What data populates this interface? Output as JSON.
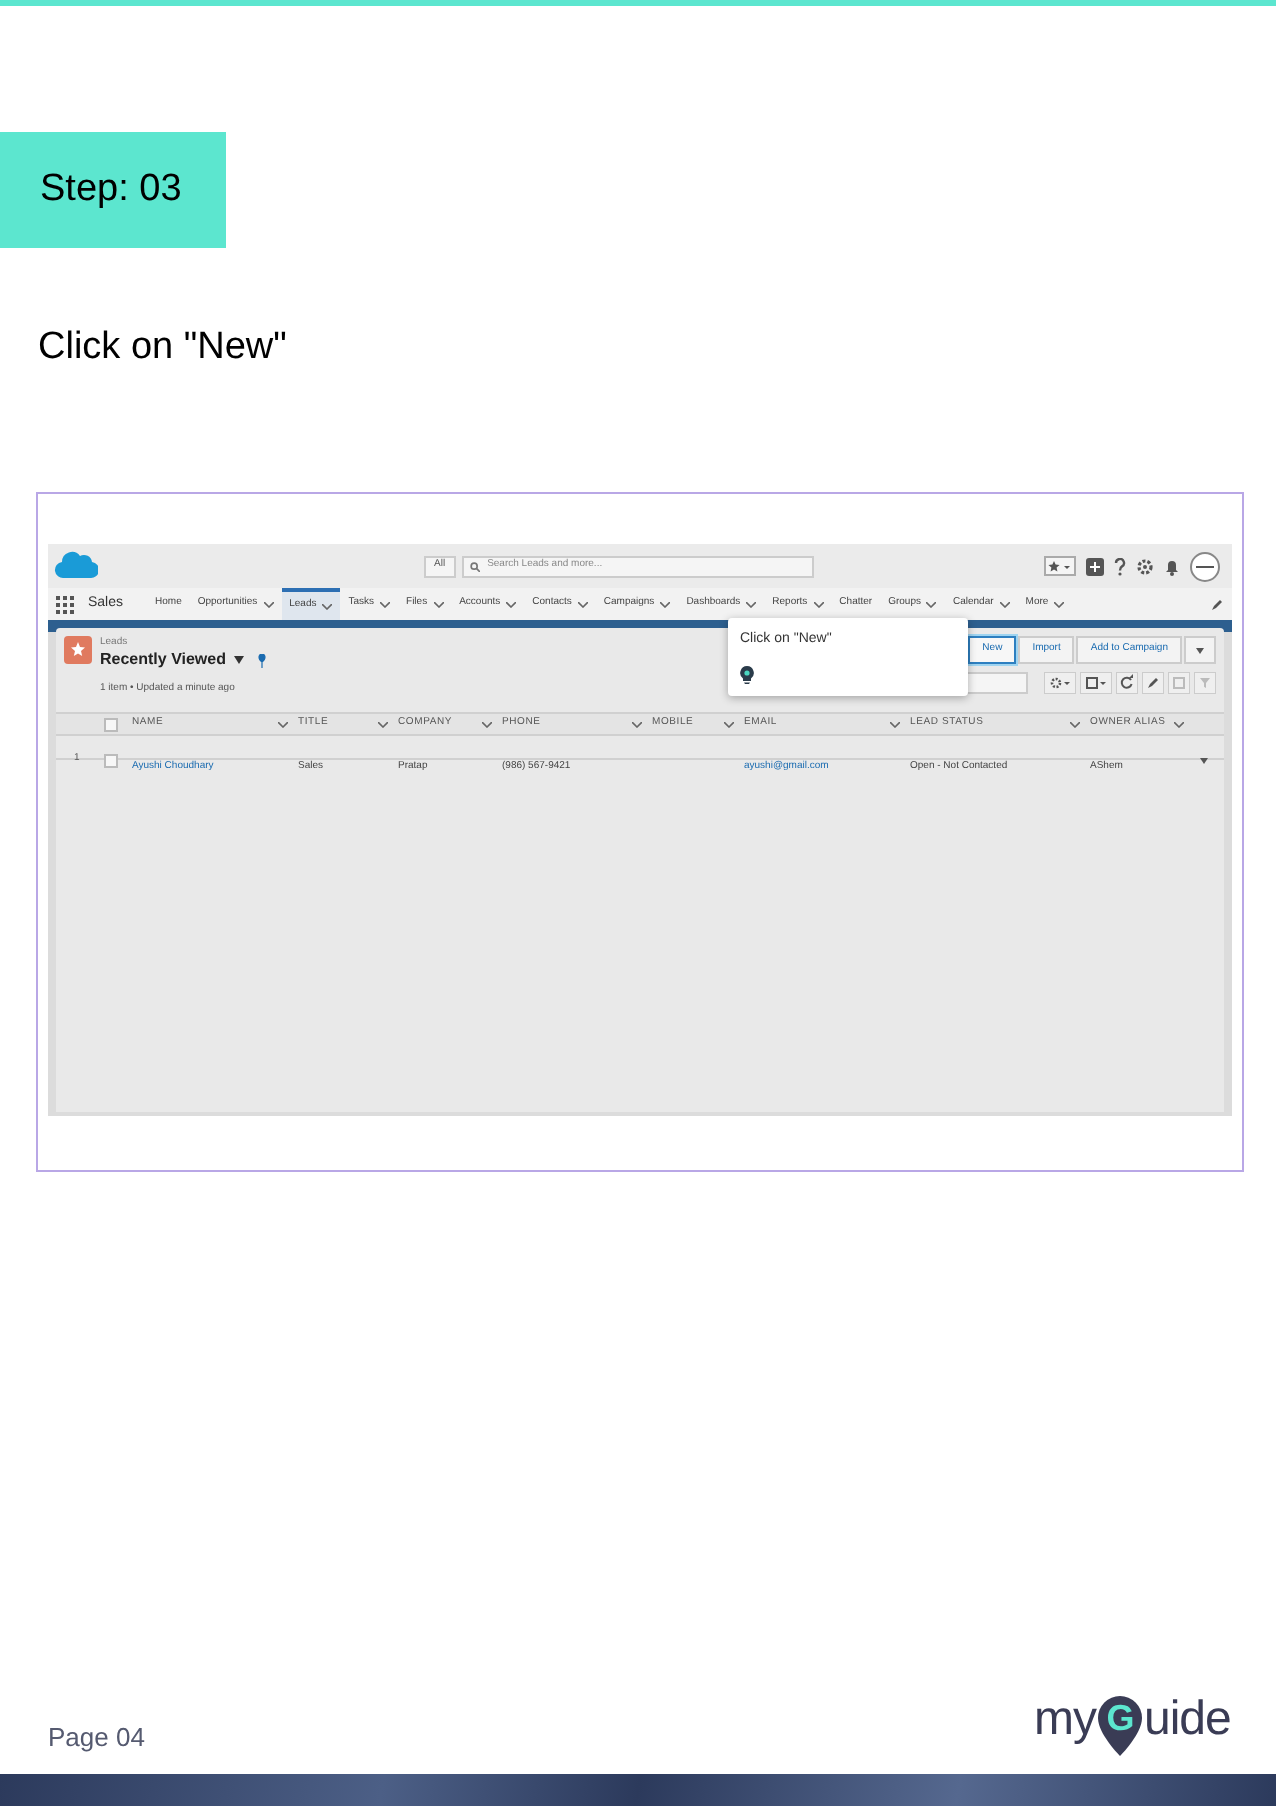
{
  "step": "Step: 03",
  "instruction": "Click on \"New\"",
  "app": {
    "search_scope": "All",
    "search_placeholder": "Search Leads and more...",
    "app_name": "Sales",
    "nav": [
      {
        "label": "Home",
        "selected": false,
        "dropdown": false
      },
      {
        "label": "Opportunities",
        "selected": false,
        "dropdown": true
      },
      {
        "label": "Leads",
        "selected": true,
        "dropdown": true
      },
      {
        "label": "Tasks",
        "selected": false,
        "dropdown": true
      },
      {
        "label": "Files",
        "selected": false,
        "dropdown": true
      },
      {
        "label": "Accounts",
        "selected": false,
        "dropdown": true
      },
      {
        "label": "Contacts",
        "selected": false,
        "dropdown": true
      },
      {
        "label": "Campaigns",
        "selected": false,
        "dropdown": true
      },
      {
        "label": "Dashboards",
        "selected": false,
        "dropdown": true
      },
      {
        "label": "Reports",
        "selected": false,
        "dropdown": true
      },
      {
        "label": "Chatter",
        "selected": false,
        "dropdown": false
      },
      {
        "label": "Groups",
        "selected": false,
        "dropdown": true
      },
      {
        "label": "Calendar",
        "selected": false,
        "dropdown": true
      },
      {
        "label": "More",
        "selected": false,
        "dropdown": true
      }
    ],
    "object_label": "Leads",
    "list_view": "Recently Viewed",
    "meta": "1 item • Updated a minute ago",
    "buttons": [
      {
        "label": "New",
        "highlighted": true
      },
      {
        "label": "Import",
        "highlighted": false
      },
      {
        "label": "Add to Campaign",
        "highlighted": false
      }
    ],
    "select_all_checked": false,
    "columns": [
      "NAME",
      "TITLE",
      "COMPANY",
      "PHONE",
      "MOBILE",
      "EMAIL",
      "LEAD STATUS",
      "OWNER ALIAS"
    ],
    "rows": [
      {
        "number": "1",
        "checked": false,
        "cells": [
          {
            "text": "Ayushi Choudhary",
            "kind": "link"
          },
          {
            "text": "Sales",
            "kind": "text"
          },
          {
            "text": "Pratap",
            "kind": "text"
          },
          {
            "text": "(986) 567-9421",
            "kind": "text"
          },
          null,
          {
            "text": "ayushi@gmail.com",
            "kind": "link"
          },
          {
            "text": "Open - Not Contacted",
            "kind": "text"
          },
          {
            "text": "AShem",
            "kind": "text"
          }
        ]
      }
    ]
  },
  "tooltip": {
    "text": "Click on \"New\""
  },
  "footer": {
    "page": "Page 04",
    "logo": [
      "my",
      "G",
      "uide"
    ]
  }
}
